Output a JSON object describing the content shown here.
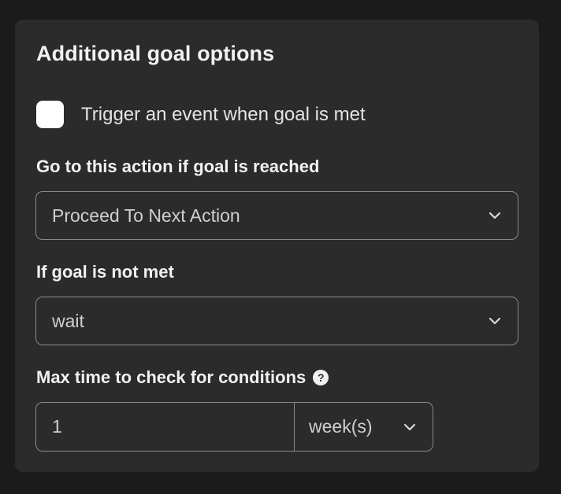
{
  "panel": {
    "title": "Additional goal options"
  },
  "trigger_event": {
    "label": "Trigger an event when goal is met",
    "checked": false
  },
  "goal_reached": {
    "label": "Go to this action if goal is reached",
    "selected": "Proceed To Next Action"
  },
  "goal_not_met": {
    "label": "If goal is not met",
    "selected": "wait"
  },
  "max_time": {
    "label": "Max time to check for conditions",
    "help_icon": "?",
    "value": "1",
    "unit": "week(s)"
  },
  "icons": {
    "chevron": "chevron-down-icon",
    "help": "question-circle-icon"
  },
  "colors": {
    "background": "#1b1b1b",
    "panel": "#2b2b2b",
    "border": "#8a8a8a",
    "text": "#f1f1f1",
    "muted_text": "#cfcfcf"
  }
}
